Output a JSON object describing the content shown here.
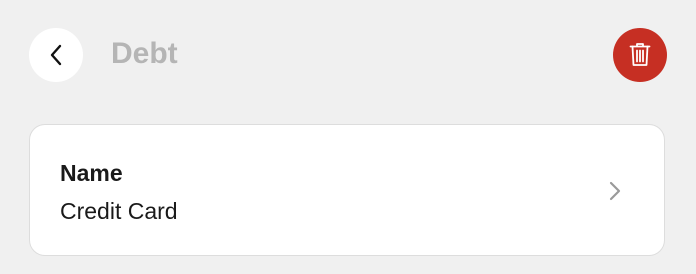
{
  "header": {
    "title": "Debt",
    "back_icon": "chevron-left-icon",
    "delete_icon": "trash-icon"
  },
  "colors": {
    "background": "#f0f0f0",
    "delete_button": "#c62f23",
    "title_text": "#b5b5b5"
  },
  "card": {
    "label": "Name",
    "value": "Credit Card",
    "trailing_icon": "chevron-right-icon"
  }
}
